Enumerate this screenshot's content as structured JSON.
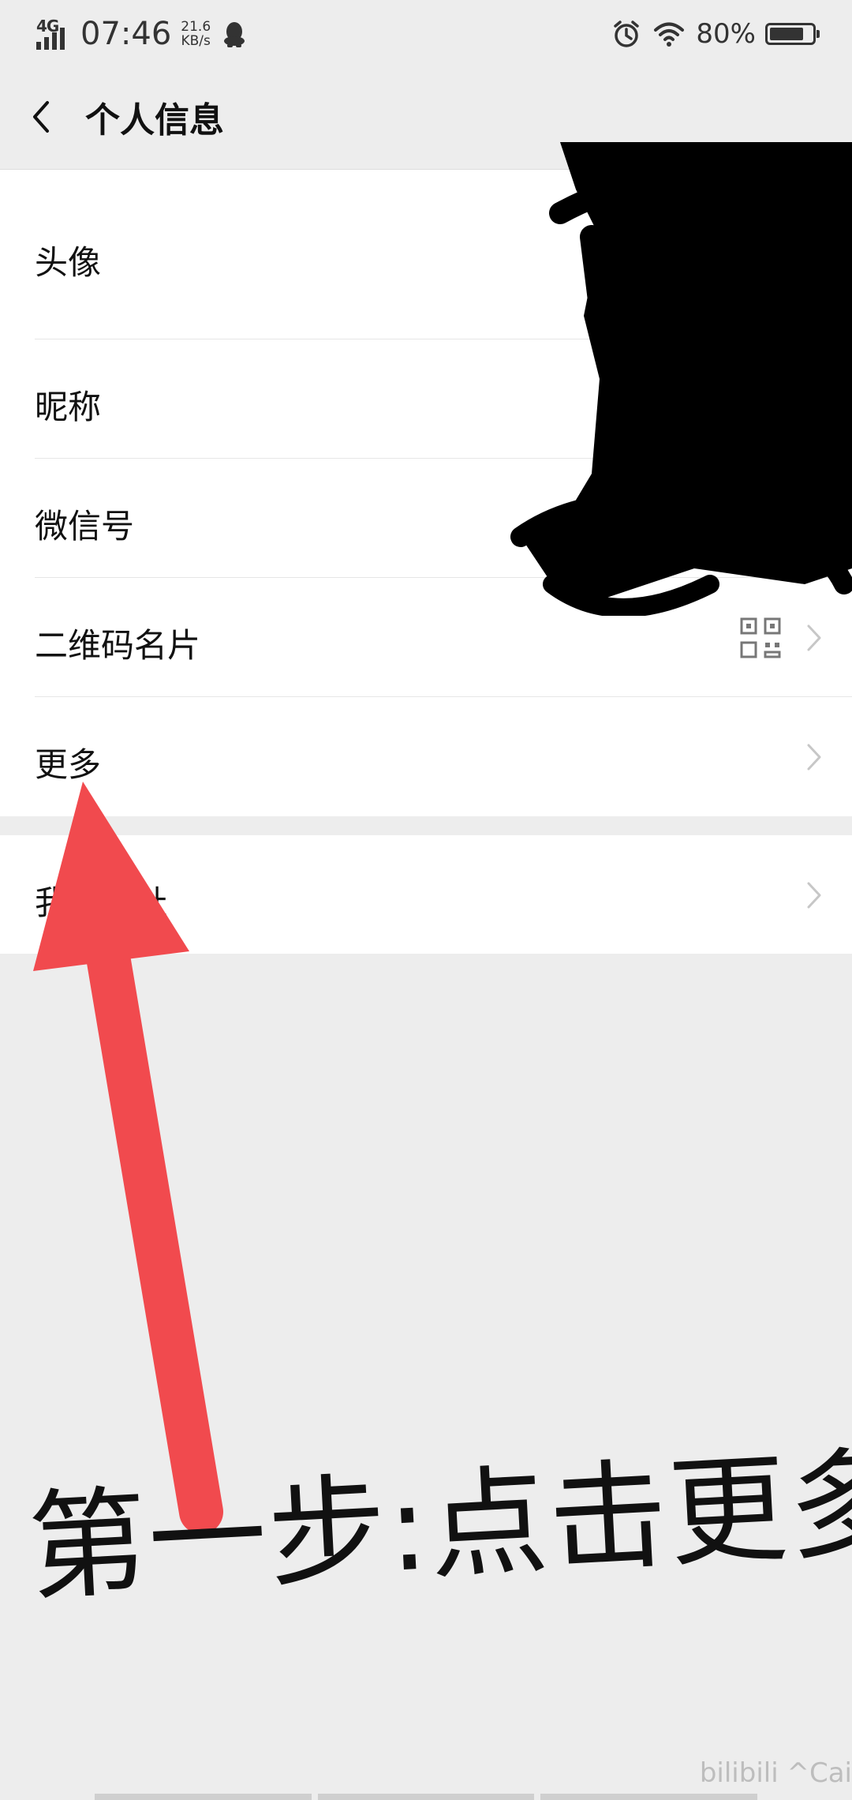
{
  "status_bar": {
    "network": "4G",
    "time": "07:46",
    "speed_value": "21.6",
    "speed_unit": "KB/s",
    "battery_pct": "80%",
    "battery_level": 0.8
  },
  "header": {
    "title": "个人信息"
  },
  "list_section_1": {
    "items": [
      {
        "label": "头像"
      },
      {
        "label": "昵称"
      },
      {
        "label": "微信号"
      },
      {
        "label": "二维码名片"
      },
      {
        "label": "更多"
      }
    ]
  },
  "list_section_2": {
    "items": [
      {
        "label": "我的地址"
      }
    ]
  },
  "annotation": {
    "caption": "第一步:点击更多"
  },
  "watermark": {
    "text": "bilibili ^Cai"
  },
  "colors": {
    "background": "#ededed",
    "list_bg": "#ffffff",
    "arrow": "#f14a4e",
    "redaction": "#000000"
  },
  "icons": {
    "back": "chevron-left-icon",
    "qr": "qr-code-icon",
    "chevron": "chevron-right-icon",
    "alarm": "alarm-icon",
    "wifi": "wifi-icon",
    "battery": "battery-icon",
    "qq": "qq-penguin-icon"
  }
}
